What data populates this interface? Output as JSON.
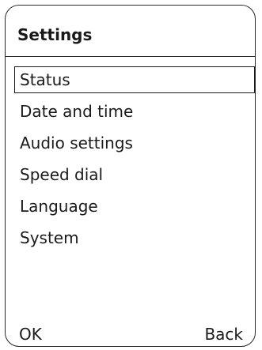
{
  "screen": {
    "title": "Settings"
  },
  "menu": {
    "selected_index": 0,
    "items": [
      {
        "label": "Status"
      },
      {
        "label": "Date and time"
      },
      {
        "label": "Audio settings"
      },
      {
        "label": "Speed dial"
      },
      {
        "label": "Language"
      },
      {
        "label": "System"
      }
    ]
  },
  "softkeys": {
    "left_label": "OK",
    "right_label": "Back"
  }
}
